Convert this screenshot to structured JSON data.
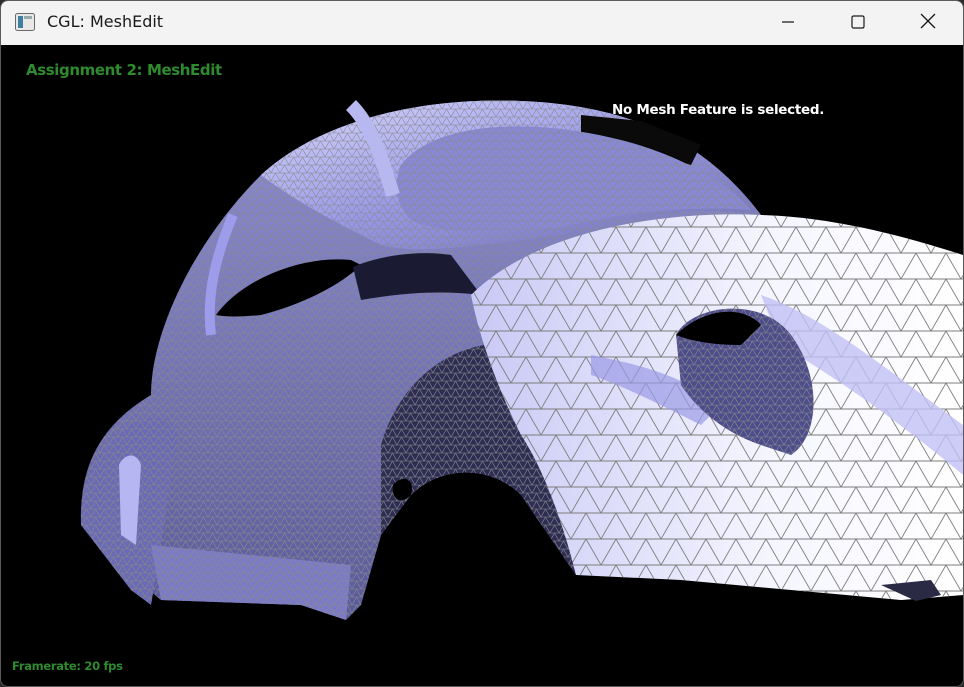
{
  "window": {
    "title": "CGL: MeshEdit",
    "app_icon": "cgl-app-icon",
    "controls": {
      "minimize_icon": "minimize-icon",
      "maximize_icon": "maximize-icon",
      "close_icon": "close-icon"
    }
  },
  "viewport": {
    "assignment_label": "Assignment 2: MeshEdit",
    "selection_status": "No Mesh Feature is selected.",
    "framerate_label": "Framerate: 20 fps",
    "scene": "3D triangle mesh rendering of a car body (wireframe over shaded surface)"
  },
  "colors": {
    "hud_text": "#2e8b2e",
    "status_text": "#ffffff",
    "background": "#000000",
    "mesh_fill_light": "#f2f2ff",
    "mesh_fill_mid": "#a9a9f2",
    "mesh_fill_dark": "#5c5c9e",
    "wire": "#8a8a8a"
  }
}
